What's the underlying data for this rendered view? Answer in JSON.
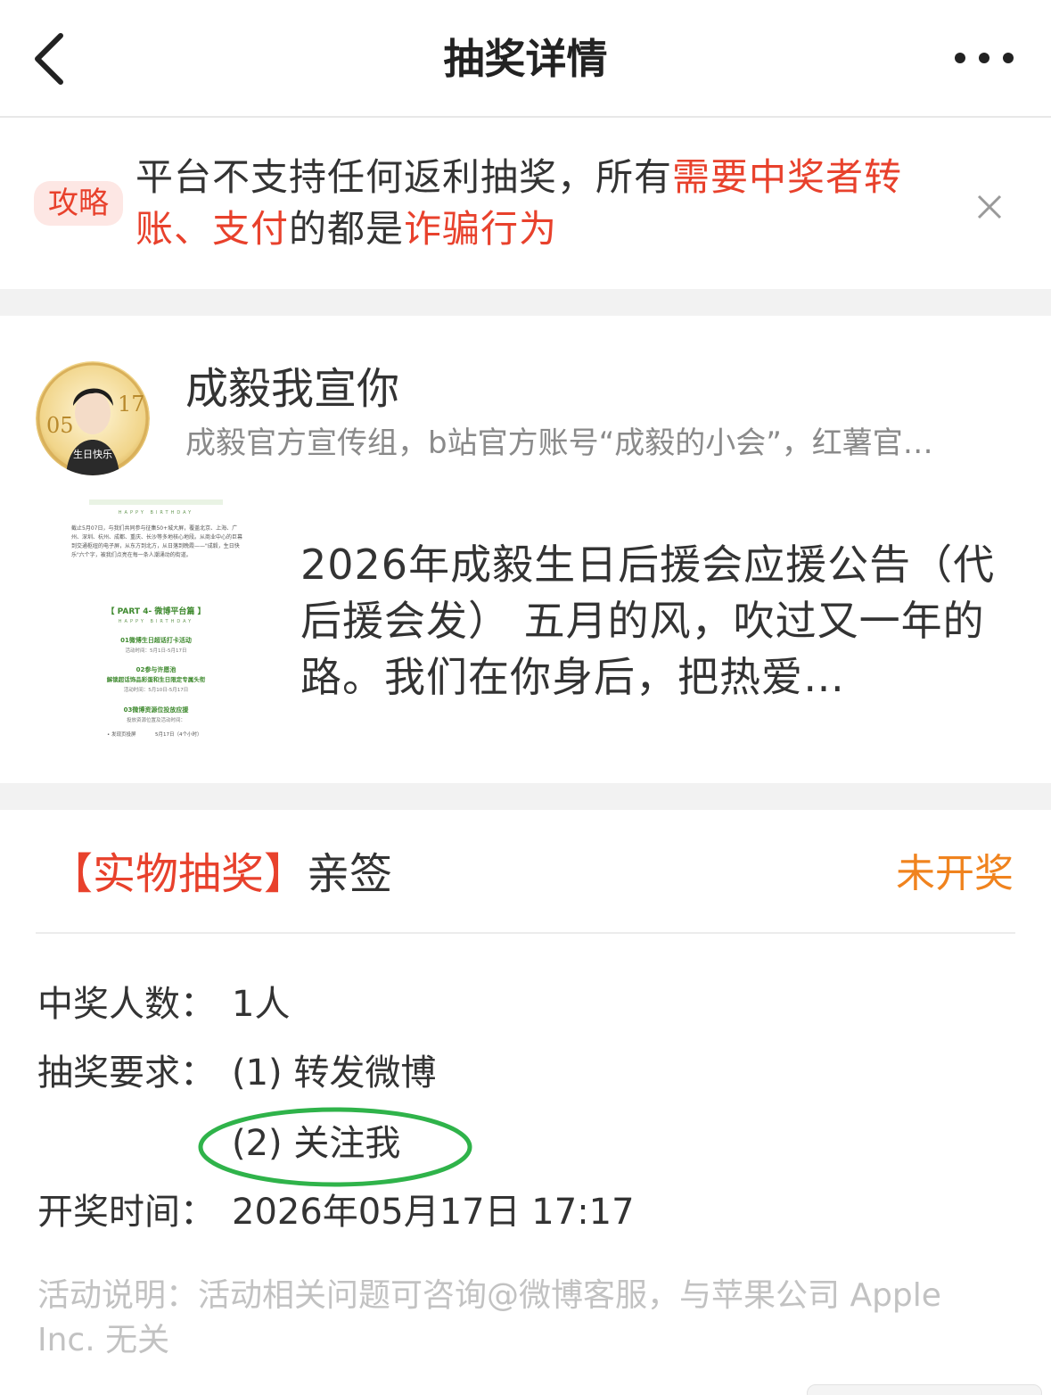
{
  "header": {
    "title": "抽奖详情",
    "back_icon": "chevron-left-icon",
    "more_icon": "more-dots-icon"
  },
  "banner": {
    "tag": "攻略",
    "text_1": "平台不支持任何返利抽奖，所有",
    "text_red_1": "需要中奖者转账、支付",
    "text_2": "的都是",
    "text_red_2": "诈骗行为",
    "close_icon": "close-icon",
    "accent_color": "#e8412c"
  },
  "author": {
    "name": "成毅我宣你",
    "description": "成毅官方宣传组，b站官方账号“成毅的小会”，红薯官…",
    "avatar_badge": {
      "left": "05",
      "right": "17",
      "caption": "生日快乐"
    }
  },
  "post": {
    "text": "2026年成毅生日后援会应援公告（代后援会发） 五月的风，吹过又一年的路。我们在你身后，把热爱…",
    "thumbnail": {
      "header": "HAPPY BIRTHDAY",
      "lines": [
        "截止5月07日，与我们共同参与征集50+城大屏，覆盖北京、上海、广州、深圳、杭州、成都、重庆、长沙等多地核心地段。从商业中心的巨幕到交通枢纽的电子屏，从东方到北方，从日落到晚霞——\"成毅，生日快乐\"六个字，被我们点亮在每一条人潮涌动的街道。"
      ],
      "part_title": "【 PART 4- 微博平台篇 】",
      "part_sub": "HAPPY BIRTHDAY",
      "items": [
        {
          "title": "01微博生日超话打卡活动",
          "sub": "活动时间：5月1日-5月17日"
        },
        {
          "title": "02参与许愿池",
          "title2": "解锁超话饰品彩蛋和生日限定专属头衔",
          "sub": "活动时间：5月10日-5月17日"
        },
        {
          "title": "03微博资源位投放应援",
          "sub": "投放资源位置及活动时间："
        }
      ],
      "footer_left": "• 发现页投屏",
      "footer_right": "5月17日（4个小时）"
    }
  },
  "lottery": {
    "type_label": "【实物抽奖】",
    "prize": "亲签",
    "status": "未开奖",
    "status_color": "#f0831e",
    "winners_label": "中奖人数：",
    "winners_value": "1人",
    "requirement_label": "抽奖要求：",
    "requirement_1": "(1) 转发微博",
    "requirement_2": "(2) 关注我",
    "draw_time_label": "开奖时间：",
    "draw_time_value": "2026年05月17日 17:17",
    "footnote": "活动说明：活动相关问题可咨询@微博客服，与苹果公司 Apple Inc. 无关"
  }
}
